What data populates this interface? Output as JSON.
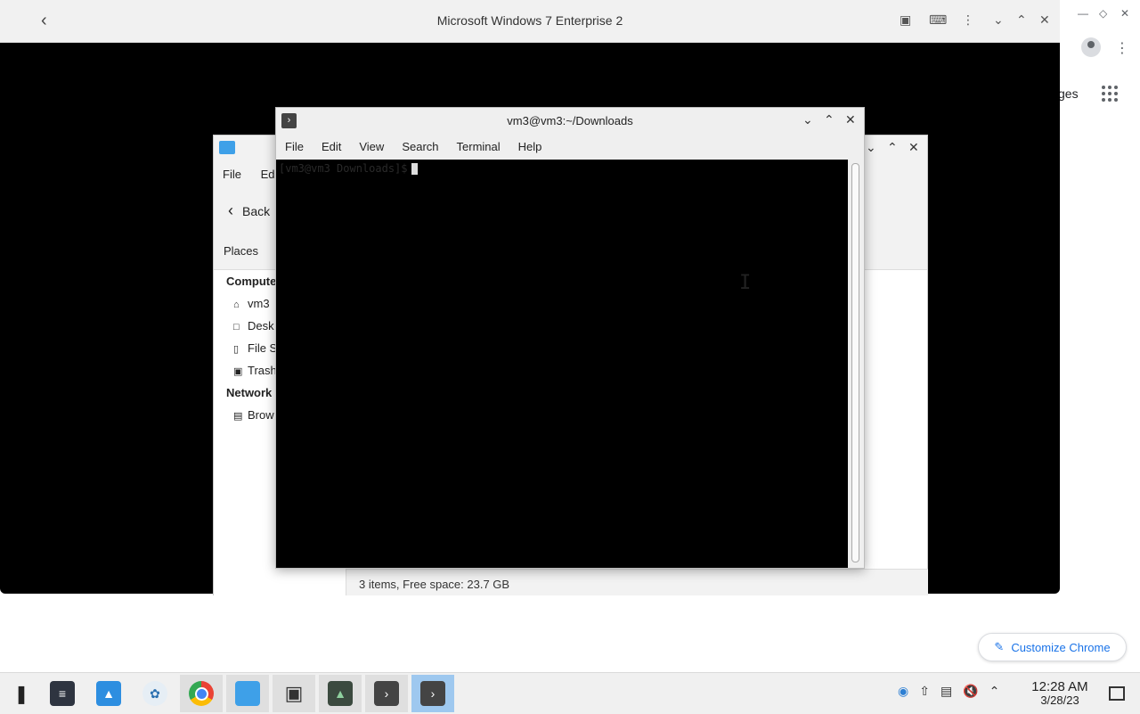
{
  "chrome": {
    "images_link": "ges",
    "customize_label": "Customize Chrome"
  },
  "vm": {
    "title": "Microsoft Windows 7 Enterprise 2"
  },
  "file_manager": {
    "menu": [
      "File",
      "Edi"
    ],
    "back_label": "Back",
    "places_label": "Places",
    "group_computer": "Compute",
    "group_network": "Network",
    "items": [
      "vm3",
      "Desk",
      "File S",
      "Trash",
      "Brow"
    ],
    "status": "3 items, Free space: 23.7 GB"
  },
  "terminal": {
    "title": "vm3@vm3:~/Downloads",
    "menu": [
      "File",
      "Edit",
      "View",
      "Search",
      "Terminal",
      "Help"
    ],
    "prompt": "[vm3@vm3 Downloads]$"
  },
  "taskbar": {
    "clock_time": "12:28 AM",
    "clock_date": "3/28/23",
    "apps": [
      "launcher",
      "settings",
      "software-store",
      "vm-app",
      "chrome",
      "files",
      "screenshot",
      "system-monitor",
      "terminal",
      "terminal-active"
    ]
  }
}
